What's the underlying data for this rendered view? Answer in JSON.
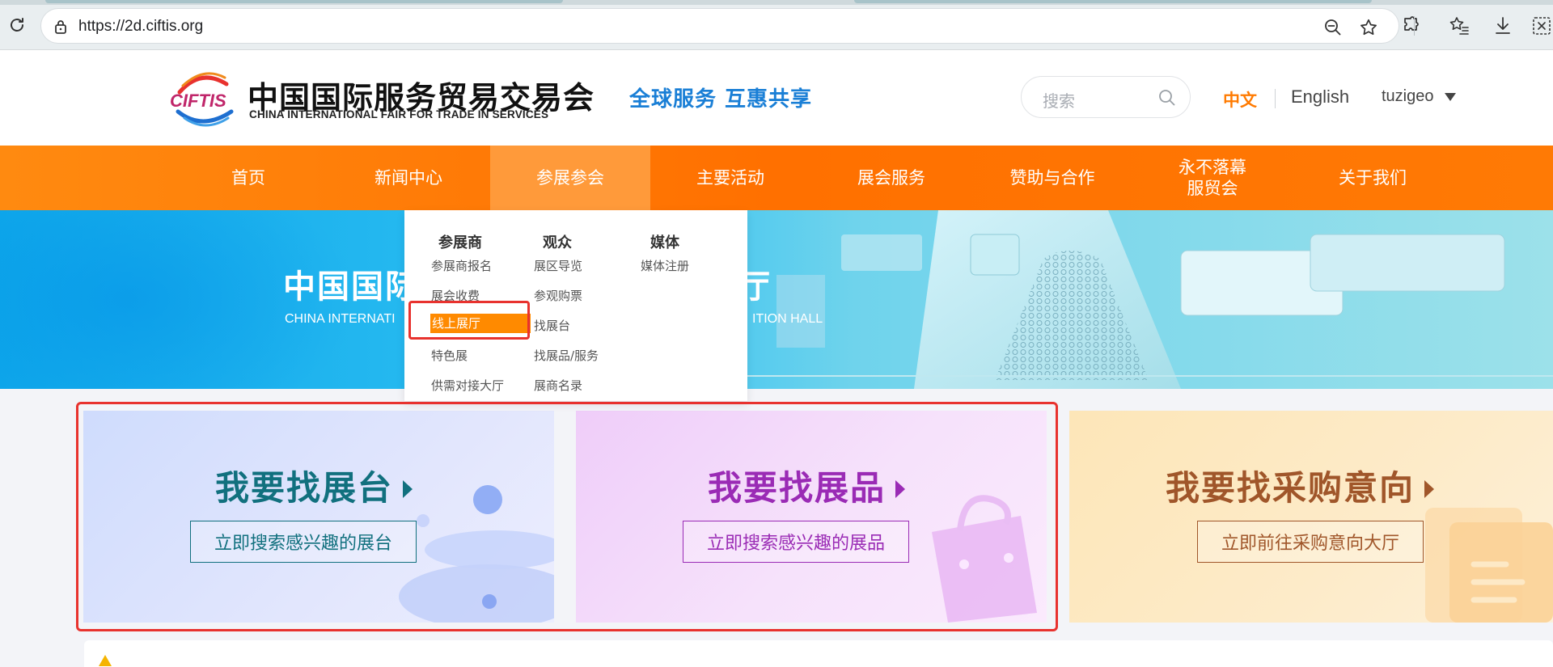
{
  "browser": {
    "url": "https://2d.ciftis.org"
  },
  "header": {
    "logo_mark_text": "CIFTIS",
    "logo_cn": "中国国际服务贸易交易会",
    "logo_en": "CHINA INTERNATIONAL FAIR FOR TRADE IN SERVICES",
    "slogan": "全球服务 互惠共享",
    "search_placeholder": "搜索",
    "lang_zh": "中文",
    "lang_en": "English",
    "username": "tuzigeo"
  },
  "nav": {
    "items": [
      {
        "label": "首页"
      },
      {
        "label": "新闻中心"
      },
      {
        "label": "参展参会"
      },
      {
        "label": "主要活动"
      },
      {
        "label": "展会服务"
      },
      {
        "label": "赞助与合作"
      },
      {
        "label": "永不落幕\n服贸会"
      },
      {
        "label": "关于我们"
      }
    ],
    "active_index": 2
  },
  "banner": {
    "title_left": "中国国际",
    "title_right": "厅",
    "subtitle_left": "CHINA INTERNATI",
    "subtitle_right": "ITION HALL"
  },
  "dropdown": {
    "columns": [
      {
        "heading": "参展商",
        "links": [
          "参展商报名",
          "展会收费",
          "线上展厅",
          "特色展",
          "供需对接大厅"
        ]
      },
      {
        "heading": "观众",
        "links": [
          "展区导览",
          "参观购票",
          "找展台",
          "找展品/服务",
          "展商名录"
        ]
      },
      {
        "heading": "媒体",
        "links": [
          "媒体注册"
        ]
      }
    ],
    "highlighted": "线上展厅"
  },
  "cards": [
    {
      "title": "我要找展台",
      "button": "立即搜索感兴趣的展台",
      "color": "#11707e"
    },
    {
      "title": "我要找展品",
      "button": "立即搜索感兴趣的展品",
      "color": "#9a2bb5"
    },
    {
      "title": "我要找采购意向",
      "button": "立即前往采购意向大厅",
      "color": "#a0562a"
    }
  ],
  "colors": {
    "accent_orange": "#ff7a00",
    "nav_active": "#ff9a3a",
    "slogan_blue": "#1a7fd6",
    "annotation_red": "#e8322e"
  }
}
